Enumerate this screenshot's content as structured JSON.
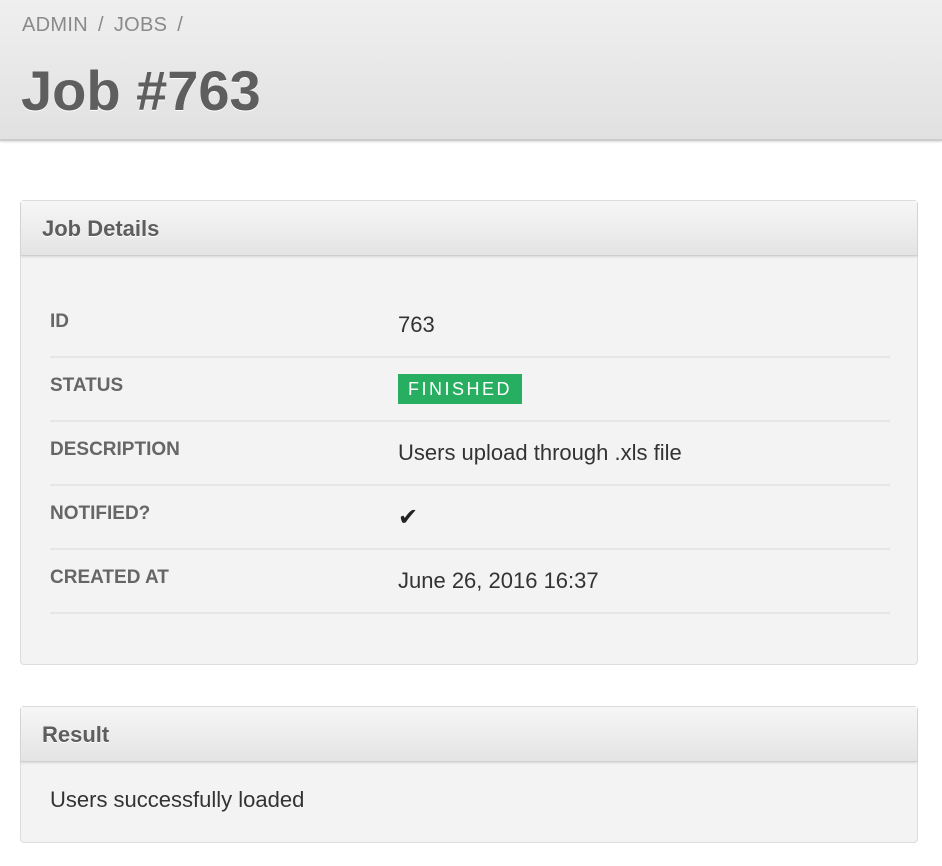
{
  "breadcrumb": {
    "items": [
      "ADMIN",
      "JOBS"
    ],
    "separator": "/"
  },
  "page": {
    "title": "Job #763"
  },
  "details_panel": {
    "title": "Job Details",
    "rows": [
      {
        "label": "ID",
        "value": "763"
      },
      {
        "label": "STATUS",
        "value": "FINISHED"
      },
      {
        "label": "DESCRIPTION",
        "value": "Users upload through .xls file"
      },
      {
        "label": "NOTIFIED?",
        "value": "✔"
      },
      {
        "label": "CREATED AT",
        "value": "June 26, 2016 16:37"
      }
    ],
    "status_color": "#27ae60",
    "notified_icon": "checkmark-icon"
  },
  "result_panel": {
    "title": "Result",
    "text": "Users successfully loaded"
  }
}
